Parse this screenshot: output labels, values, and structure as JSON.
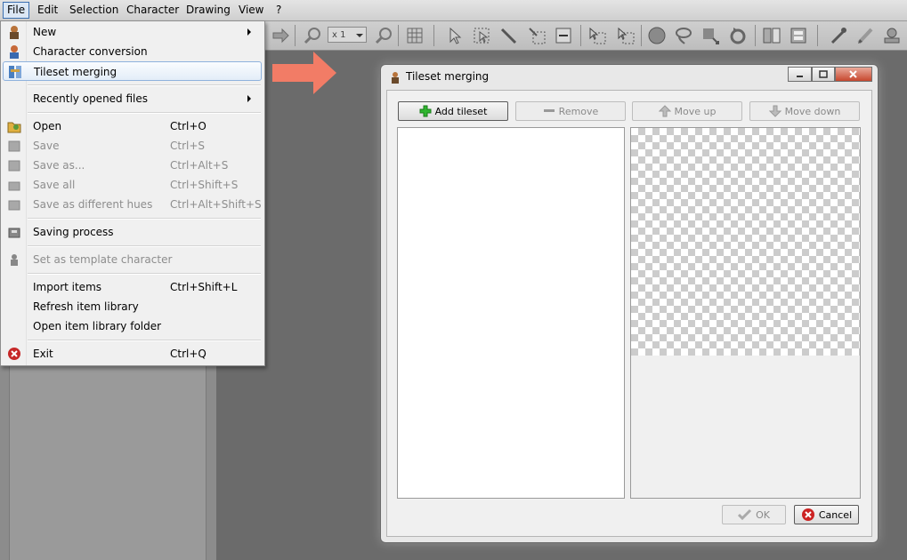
{
  "menubar": {
    "items": [
      {
        "label": "File"
      },
      {
        "label": "Edit"
      },
      {
        "label": "Selection"
      },
      {
        "label": "Character"
      },
      {
        "label": "Drawing"
      },
      {
        "label": "View"
      },
      {
        "label": "?"
      }
    ]
  },
  "toolbar": {
    "zoom_value": "x 1"
  },
  "file_menu": {
    "items": [
      {
        "label": "New",
        "shortcut": "",
        "icon": "new-character-icon",
        "disabled": false,
        "submenu": true
      },
      {
        "label": "Character conversion",
        "shortcut": "",
        "icon": "conversion-icon",
        "disabled": false
      },
      {
        "label": "Tileset merging",
        "shortcut": "",
        "icon": "tileset-merge-icon",
        "disabled": false,
        "highlighted": true
      },
      {
        "label": "Recently opened files",
        "shortcut": "",
        "icon": "",
        "disabled": false,
        "submenu": true
      },
      {
        "label": "Open",
        "shortcut": "Ctrl+O",
        "icon": "open-folder-icon",
        "disabled": false
      },
      {
        "label": "Save",
        "shortcut": "Ctrl+S",
        "icon": "save-icon",
        "disabled": true
      },
      {
        "label": "Save as...",
        "shortcut": "Ctrl+Alt+S",
        "icon": "save-as-icon",
        "disabled": true
      },
      {
        "label": "Save all",
        "shortcut": "Ctrl+Shift+S",
        "icon": "save-all-icon",
        "disabled": true
      },
      {
        "label": "Save as different hues",
        "shortcut": "Ctrl+Alt+Shift+S",
        "icon": "save-hues-icon",
        "disabled": true
      },
      {
        "label": "Saving process",
        "shortcut": "",
        "icon": "saving-process-icon",
        "disabled": false
      },
      {
        "label": "Set as template character",
        "shortcut": "",
        "icon": "template-icon",
        "disabled": true
      },
      {
        "label": "Import items",
        "shortcut": "Ctrl+Shift+L",
        "icon": "",
        "disabled": false
      },
      {
        "label": "Refresh item library",
        "shortcut": "",
        "icon": "",
        "disabled": false
      },
      {
        "label": "Open item library folder",
        "shortcut": "",
        "icon": "",
        "disabled": false
      },
      {
        "label": "Exit",
        "shortcut": "Ctrl+Q",
        "icon": "exit-icon",
        "disabled": false
      }
    ]
  },
  "dialog": {
    "title": "Tileset merging",
    "buttons": {
      "add": "Add tileset",
      "remove": "Remove",
      "move_up": "Move up",
      "move_down": "Move down",
      "ok": "OK",
      "cancel": "Cancel"
    }
  },
  "colors": {
    "arrow": "#f27c66",
    "add_icon": "#2fb52f",
    "cancel_icon": "#cc2222",
    "highlight_border": "#8fb2dd"
  }
}
